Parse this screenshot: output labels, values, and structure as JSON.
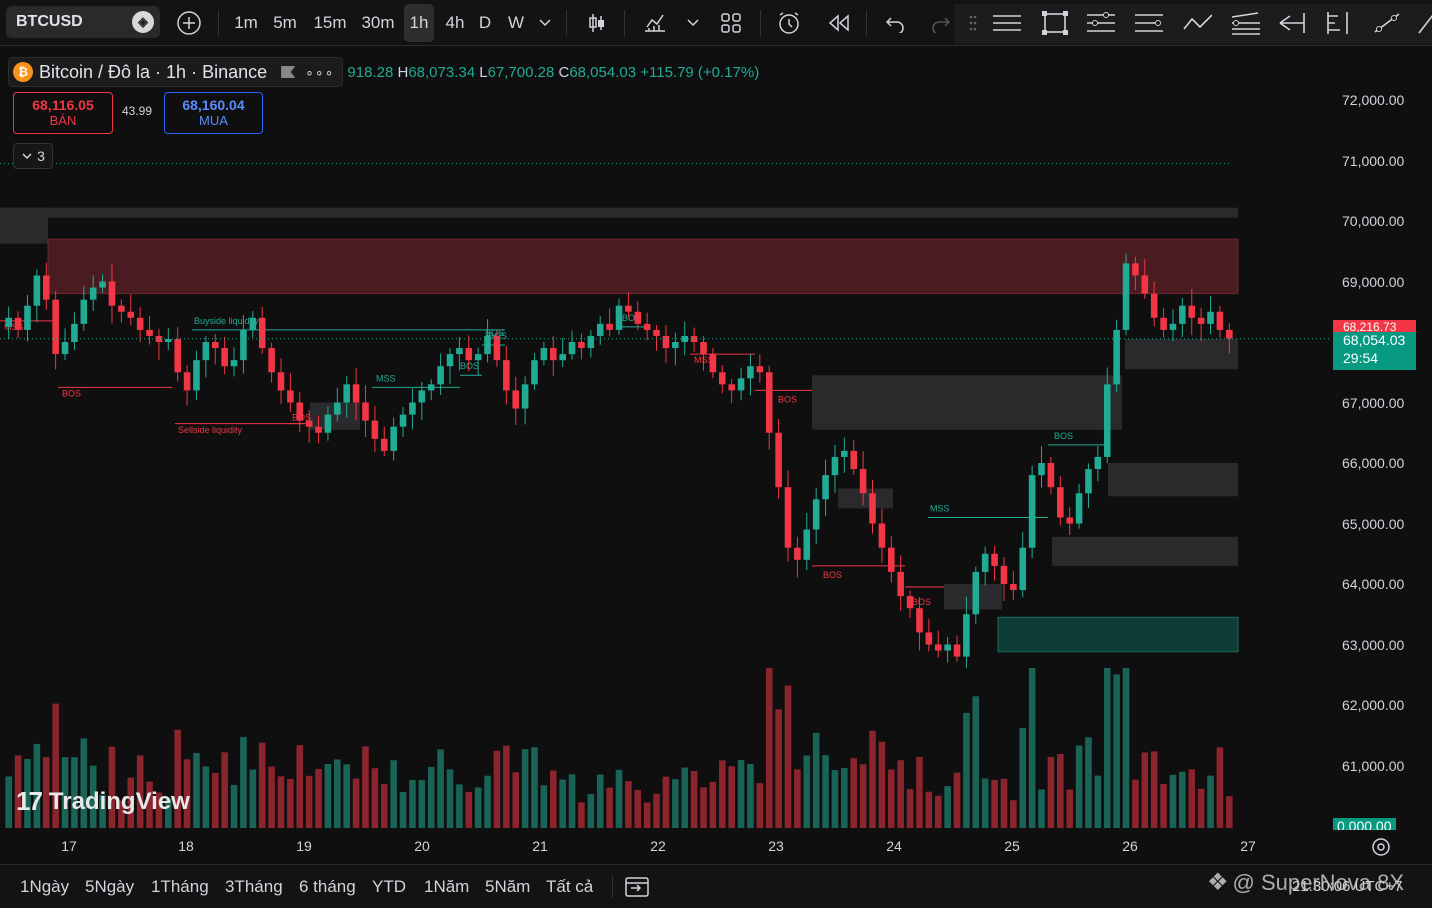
{
  "toolbar": {
    "symbol": "BTCUSD",
    "intervals": [
      "1m",
      "5m",
      "15m",
      "30m",
      "1h",
      "4h",
      "D",
      "W"
    ],
    "active_interval": "1h"
  },
  "legend": {
    "title": "Bitcoin / Đô la · 1h · Binance",
    "more": "∘∘∘",
    "ohlc_prefix_val": "918.28",
    "h_key": "H",
    "h_val": "68,073.34",
    "l_key": "L",
    "l_val": "67,700.28",
    "c_key": "C",
    "c_val": "68,054.03",
    "change": "+115.79 (+0.17%)"
  },
  "trade": {
    "sell_price": "68,116.05",
    "sell_label": "BÁN",
    "spread": "43.99",
    "buy_price": "68,160.04",
    "buy_label": "MUA",
    "indicators_count": "3"
  },
  "price_axis": {
    "ticks": [
      "72,000.00",
      "71,000.00",
      "70,000.00",
      "69,000.00",
      "67,000.00",
      "66,000.00",
      "65,000.00",
      "64,000.00",
      "63,000.00",
      "62,000.00",
      "61,000.00"
    ],
    "current_price": "68,054.03",
    "countdown": "29:54",
    "partial_red": "68,216.73",
    "volume_tag": "0.000.00"
  },
  "time_axis": {
    "ticks": [
      "17",
      "18",
      "19",
      "20",
      "21",
      "22",
      "23",
      "24",
      "25",
      "26",
      "27"
    ]
  },
  "annotations": {
    "buyside": "Buyside liquidity",
    "sellside": "Sellside liquidity",
    "mss": "MSS",
    "bos": "BOS"
  },
  "bottom": {
    "ranges": [
      "1Ngày",
      "5Ngày",
      "1Tháng",
      "3Tháng",
      "6 tháng",
      "YTD",
      "1Năm",
      "5Năm",
      "Tất cả"
    ],
    "time": "21:30:06 UTC+7",
    "watermark": "@ SuperNova 8X"
  },
  "branding": {
    "logo": "TradingView"
  },
  "colors": {
    "up": "#22ab94",
    "down": "#f23645",
    "zone_red": "#4a1c22",
    "zone_gray": "#2a2a2d",
    "zone_green": "#0d3d35"
  },
  "chart_data": {
    "type": "candlestick",
    "title": "",
    "x_range": [
      "17",
      "27"
    ],
    "y_range": [
      60500,
      72500
    ],
    "supply_zone": [
      68800,
      69700
    ],
    "closes": [
      68400,
      68200,
      68600,
      69100,
      68700,
      67800,
      68000,
      68300,
      68700,
      68900,
      69000,
      68600,
      68500,
      68400,
      68200,
      68100,
      68000,
      68050,
      67500,
      67200,
      67700,
      68000,
      67900,
      67600,
      67700,
      68200,
      68400,
      67900,
      67500,
      67200,
      67000,
      66700,
      66600,
      66500,
      66800,
      67000,
      67300,
      67000,
      66700,
      66400,
      66200,
      66600,
      66800,
      67000,
      67200,
      67300,
      67600,
      67800,
      67900,
      67700,
      67800,
      68100,
      67700,
      67200,
      66900,
      67300,
      67700,
      67900,
      67700,
      67800,
      68000,
      67900,
      68100,
      68300,
      68200,
      68600,
      68500,
      68300,
      68200,
      68100,
      67900,
      68000,
      68100,
      68000,
      67800,
      67500,
      67300,
      67200,
      67400,
      67600,
      67500,
      66500,
      65600,
      64600,
      64400,
      64900,
      65400,
      65800,
      66100,
      66200,
      65900,
      65500,
      65000,
      64600,
      64200,
      63800,
      63600,
      63200,
      63000,
      62900,
      63000,
      62800,
      63500,
      64200,
      64500,
      64300,
      64000,
      63900,
      64600,
      65800,
      66000,
      65600,
      65100,
      65000,
      65500,
      65900,
      66100,
      67300,
      68200,
      69300,
      69100,
      68800,
      68400,
      68200,
      68300,
      68600,
      68400,
      68300,
      68500,
      68200,
      68054
    ]
  }
}
